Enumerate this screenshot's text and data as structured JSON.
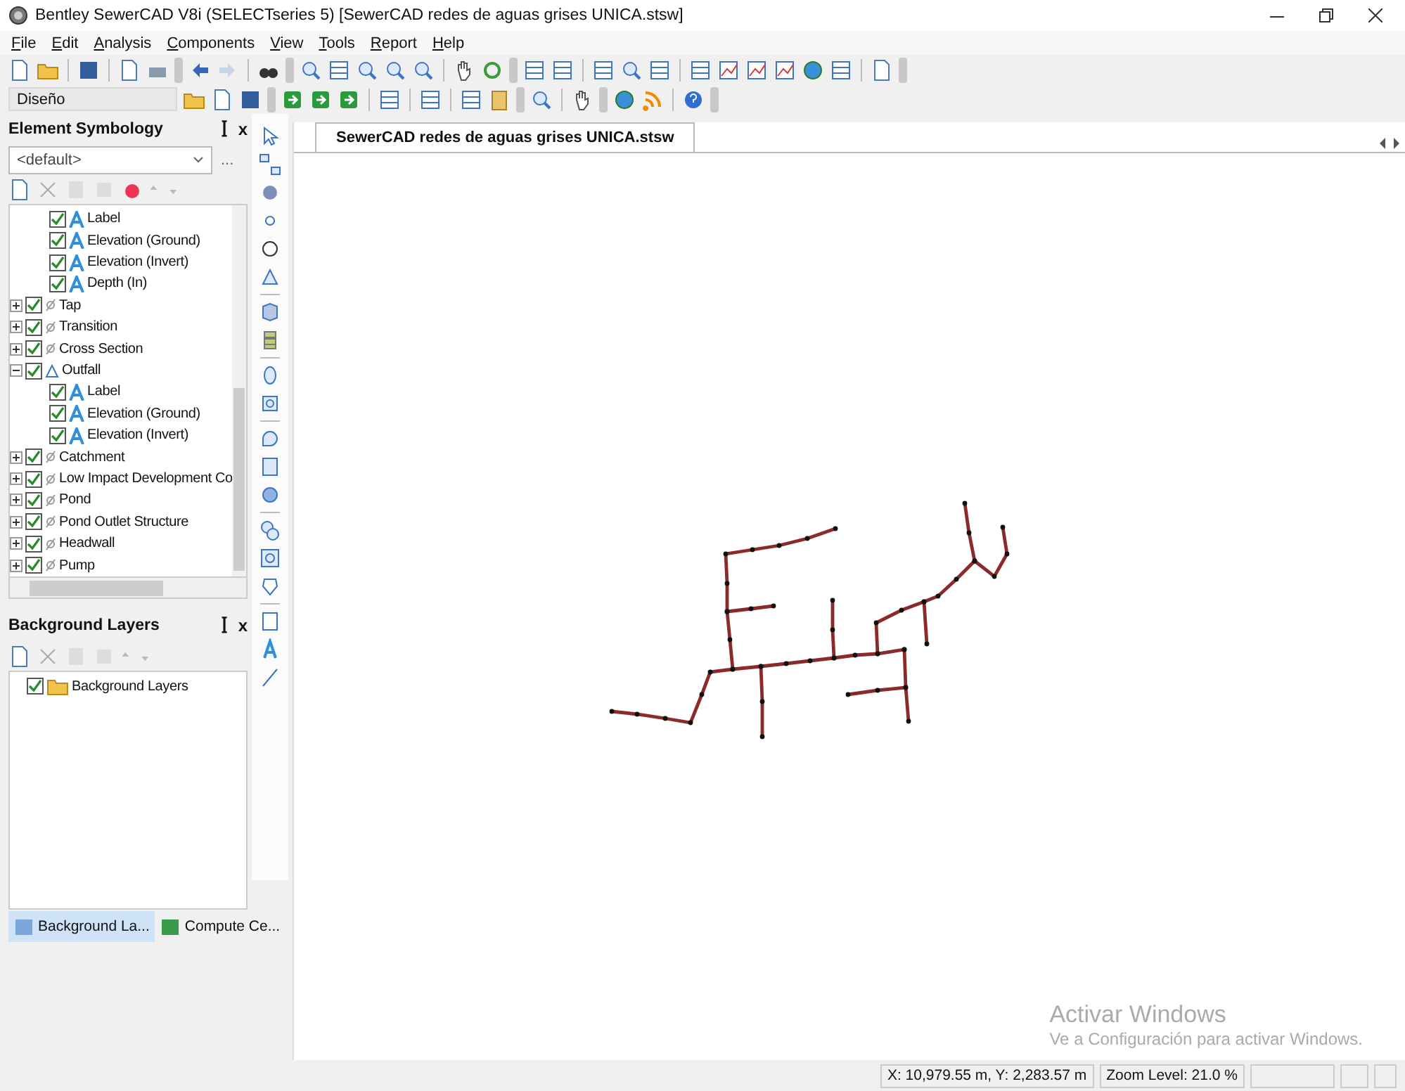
{
  "window": {
    "title": "Bentley SewerCAD V8i (SELECTseries 5) [SewerCAD redes de aguas grises UNICA.stsw]"
  },
  "menu": [
    "File",
    "Edit",
    "Analysis",
    "Components",
    "View",
    "Tools",
    "Report",
    "Help"
  ],
  "scenario_select": {
    "value": "Diseño"
  },
  "element_symbology": {
    "title": "Element Symbology",
    "pin": "ꟾ",
    "close": "x",
    "dropdown": {
      "value": "<default>"
    },
    "more": "...",
    "items": [
      {
        "children": [
          {
            "label": "Label",
            "checked": true,
            "kind": "annotation"
          },
          {
            "label": "Elevation (Ground)",
            "checked": true,
            "kind": "annotation"
          },
          {
            "label": "Elevation (Invert)",
            "checked": true,
            "kind": "annotation"
          },
          {
            "label": "Depth (In)",
            "checked": true,
            "kind": "annotation"
          }
        ]
      },
      {
        "label": "Tap",
        "checked": true,
        "kind": "element",
        "expanded": false
      },
      {
        "label": "Transition",
        "checked": true,
        "kind": "element",
        "expanded": false
      },
      {
        "label": "Cross Section",
        "checked": true,
        "kind": "element",
        "expanded": false
      },
      {
        "label": "Outfall",
        "checked": true,
        "kind": "outfall",
        "expanded": true,
        "children": [
          {
            "label": "Label",
            "checked": true,
            "kind": "annotation"
          },
          {
            "label": "Elevation (Ground)",
            "checked": true,
            "kind": "annotation"
          },
          {
            "label": "Elevation (Invert)",
            "checked": true,
            "kind": "annotation"
          }
        ]
      },
      {
        "label": "Catchment",
        "checked": true,
        "kind": "element",
        "expanded": false
      },
      {
        "label": "Low Impact Development Co",
        "checked": true,
        "kind": "element",
        "expanded": false
      },
      {
        "label": "Pond",
        "checked": true,
        "kind": "element",
        "expanded": false
      },
      {
        "label": "Pond Outlet Structure",
        "checked": true,
        "kind": "element",
        "expanded": false
      },
      {
        "label": "Headwall",
        "checked": true,
        "kind": "element",
        "expanded": false
      },
      {
        "label": "Pump",
        "checked": true,
        "kind": "element",
        "expanded": false
      }
    ]
  },
  "background_layers": {
    "title": "Background Layers",
    "pin": "ꟾ",
    "close": "x",
    "items": [
      {
        "label": "Background Layers",
        "checked": true
      }
    ]
  },
  "bottom_tabs": [
    {
      "label": "Background La...",
      "selected": true
    },
    {
      "label": "Compute Ce...",
      "selected": false
    }
  ],
  "document_tab": {
    "label": "SewerCAD redes de aguas grises UNICA.stsw",
    "selected": true
  },
  "os_notice": {
    "title": "Activar Windows",
    "text": "Ve a Configuración para activar Windows."
  },
  "status_bar": [
    "X: 10,979.55 m, Y: 2,283.57 m",
    "Zoom Level: 21.0 %"
  ]
}
